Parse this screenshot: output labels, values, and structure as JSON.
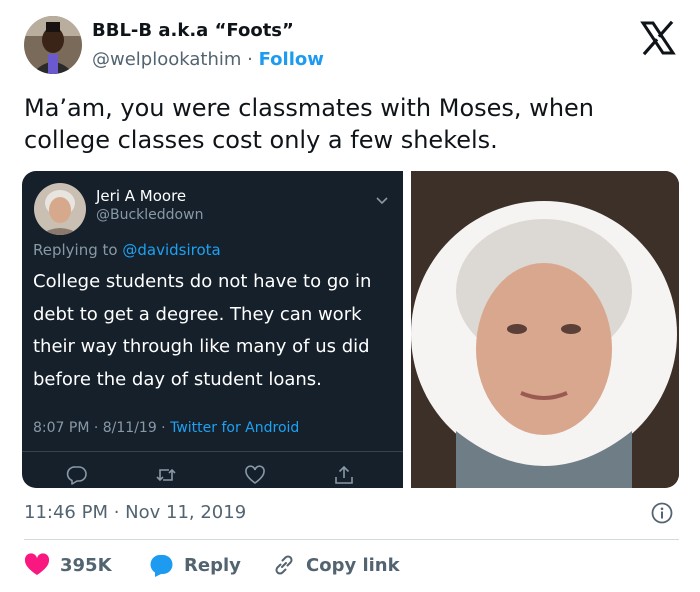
{
  "author": {
    "display_name": "BBL-B a.k.a “Foots”",
    "handle": "@welplookathim",
    "separator": "·",
    "follow_label": "Follow"
  },
  "tweet": {
    "text": "Ma’am, you were classmates with Moses, when college classes cost only a few shekels.",
    "timestamp": "11:46 PM · Nov 11, 2019"
  },
  "quoted_screenshot": {
    "name": "Jeri A Moore",
    "handle": "@Buckleddown",
    "replying_prefix": "Replying to",
    "replying_to": "@davidsirota",
    "text": "College students do not have to go in debt to get a degree. They can work their way through like many of us did before the day of student loans.",
    "meta_time": "8:07 PM · 8/11/19 ·",
    "meta_source": "Twitter for Android"
  },
  "actions": {
    "like_count": "395K",
    "reply_label": "Reply",
    "copy_label": "Copy link"
  },
  "colors": {
    "accent": "#1d9bf0",
    "like": "#f91880",
    "dark_bg": "#15202b"
  }
}
